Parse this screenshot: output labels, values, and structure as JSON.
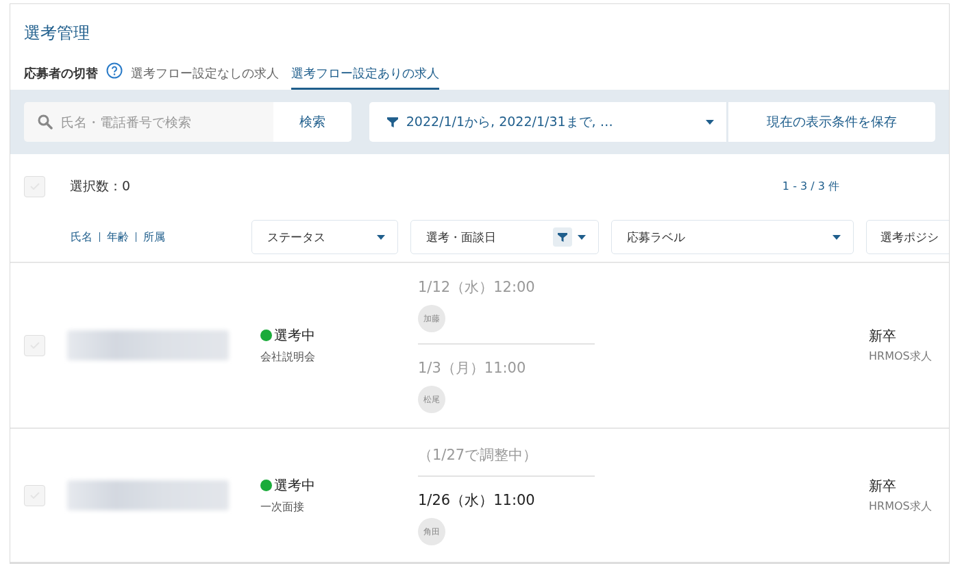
{
  "page": {
    "title": "選考管理"
  },
  "switcher": {
    "label": "応募者の切替",
    "tabs": [
      {
        "label": "選考フロー設定なしの求人",
        "selected": false
      },
      {
        "label": "選考フロー設定ありの求人",
        "selected": true
      }
    ]
  },
  "toolbar": {
    "search": {
      "placeholder": "氏名・電話番号で検索",
      "button": "検索"
    },
    "filter": {
      "label": "2022/1/1から, 2022/1/31まで, …"
    },
    "save_button": "現在の表示条件を保存"
  },
  "selection": {
    "checked": false,
    "label": "選択数：0",
    "range": "1 - 3 / 3 件"
  },
  "columns": [
    {
      "kind": "links",
      "labels": [
        "氏名",
        "年齢",
        "所属"
      ]
    },
    {
      "kind": "dropdown",
      "label": "ステータス",
      "filtered": false
    },
    {
      "kind": "dropdown",
      "label": "選考・面談日",
      "filtered": true
    },
    {
      "kind": "dropdown",
      "label": "応募ラベル",
      "filtered": false
    },
    {
      "kind": "dropdown",
      "label": "選考ポジシ",
      "filtered": false
    }
  ],
  "rows": [
    {
      "checked": false,
      "status": {
        "label": "選考中",
        "color": "#1aab3a",
        "stage": "会社説明会"
      },
      "schedule": [
        {
          "text": "1/12（水）12:00",
          "past": true,
          "interviewer": "加藤"
        },
        {
          "text": "1/3（月）11:00",
          "past": true,
          "interviewer": "松尾"
        }
      ],
      "position": {
        "type": "新卒",
        "source": "HRMOS求人"
      }
    },
    {
      "checked": false,
      "status": {
        "label": "選考中",
        "color": "#1aab3a",
        "stage": "一次面接"
      },
      "schedule": [
        {
          "text": "（1/27で調整中）",
          "past": true
        },
        {
          "text": "1/26（水）11:00",
          "past": false,
          "interviewer": "角田"
        }
      ],
      "position": {
        "type": "新卒",
        "source": "HRMOS求人"
      }
    }
  ]
}
